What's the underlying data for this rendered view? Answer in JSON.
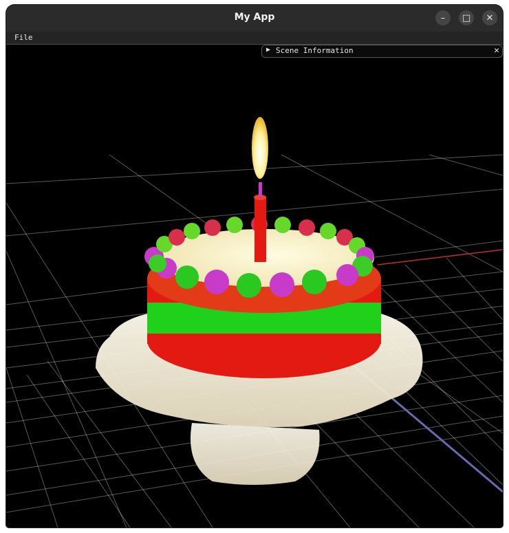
{
  "window": {
    "title": "My App"
  },
  "window_controls": {
    "minimize": "–",
    "maximize": "□",
    "close": "✕"
  },
  "menu": {
    "file": "File"
  },
  "scene_panel": {
    "title": "Scene Information",
    "expand_glyph": "▶",
    "close_glyph": "✕"
  },
  "colors": {
    "titlebar": "#2b2b2b",
    "menubar": "#242424",
    "viewport": "#000000",
    "grid": "#ffffff",
    "x_axis": "#c03030",
    "z_axis": "#6a6ab0"
  },
  "scene": {
    "object": "birthday-cake"
  }
}
